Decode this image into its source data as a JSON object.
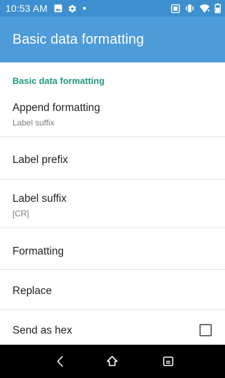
{
  "status_bar": {
    "time": "10:53 AM",
    "left_icons": [
      "image-icon",
      "gear-icon",
      "dot-icon"
    ],
    "right_icons": [
      "cast-icon",
      "vibrate-icon",
      "wifi-icon",
      "battery-icon"
    ]
  },
  "app_bar": {
    "title": "Basic data formatting"
  },
  "settings": {
    "category": "Basic data formatting",
    "items": [
      {
        "title": "Append formatting",
        "summary": "Label suffix"
      },
      {
        "title": "Label prefix",
        "summary": ""
      },
      {
        "title": "Label suffix",
        "summary": "[CR]"
      },
      {
        "title": "Formatting",
        "summary": ""
      },
      {
        "title": "Replace",
        "summary": ""
      },
      {
        "title": "Send as hex",
        "summary": "",
        "checked": false
      }
    ]
  },
  "nav_bar": {
    "buttons": [
      "back-icon",
      "home-icon",
      "recents-icon"
    ]
  },
  "colors": {
    "status_bar": "#3d8fcf",
    "app_bar": "#4d9bd9",
    "category_accent": "#1f9a85"
  }
}
